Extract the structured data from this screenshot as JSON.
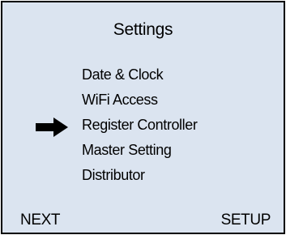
{
  "screen": {
    "title": "Settings",
    "menu_items": [
      {
        "label": "Date & Clock",
        "selected": false
      },
      {
        "label": "WiFi Access",
        "selected": false
      },
      {
        "label": "Register Controller",
        "selected": true
      },
      {
        "label": "Master Setting",
        "selected": false
      },
      {
        "label": "Distributor",
        "selected": false
      }
    ],
    "selection_icon": "right-arrow-icon",
    "softkeys": {
      "left": "NEXT",
      "right": "SETUP"
    }
  },
  "colors": {
    "screen_background": "#dbe4f0",
    "border": "#000000",
    "text": "#000000"
  }
}
